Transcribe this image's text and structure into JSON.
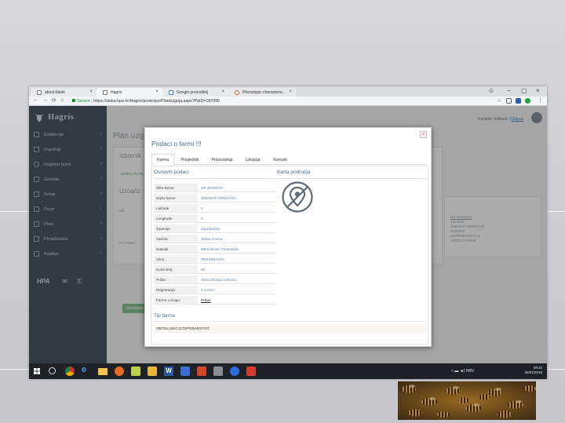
{
  "browser": {
    "tabs": [
      {
        "label": "about:blank"
      },
      {
        "label": "Hagris"
      },
      {
        "label": "Google prevoditelj"
      },
      {
        "label": "Phenotypic characteris..."
      }
    ],
    "url_secure": "Secure",
    "url": "https://stoka.hpa.hr/Hagris/pcele/pcePlanUzgoja.aspx?PplD=187095"
  },
  "app": {
    "logo_text": "Hagris",
    "user_line": "Korisnik: mdrazic |",
    "logout": "Odjava",
    "sidebar": [
      {
        "label": "Evidencije"
      },
      {
        "label": "Izvještaji"
      },
      {
        "label": "Registar farmi"
      },
      {
        "label": "Goveda"
      },
      {
        "label": "Svinje"
      },
      {
        "label": "Ovce"
      },
      {
        "label": "Ptice"
      },
      {
        "label": "Perad/ostalo"
      },
      {
        "label": "Kopitari"
      }
    ],
    "footer_logo": "HPA",
    "bg": {
      "plan_title": "Plan uzg",
      "subheading": "Izbornik",
      "add_label": "DODAJ PLAN",
      "uzgoj_label": "Uzoa/iz",
      "tbl_label": "BR.",
      "plan_label": "PLANSKA",
      "right_values": [
        "HR 20193107",
        "1614056",
        "ZDENKO CRNKOVIĆ",
        "ZAGREB",
        "KUPERBANOVA 3",
        "10000 ZAGREB"
      ],
      "save_btn": "Odustani"
    }
  },
  "modal": {
    "title": "Podaci o farmi !!!",
    "close_label": "×",
    "tabs": [
      "Farma",
      "Posjednik",
      "Proizvodnja",
      "Lokacija",
      "Kontakt"
    ],
    "section_basic": "Osnovni podaci",
    "section_map": "Karta područja",
    "fields": [
      {
        "label": "Šifra farme",
        "value": "HR 20193107"
      },
      {
        "label": "Naziv farme",
        "value": "ZDENKO CRNKOVIĆ"
      },
      {
        "label": "Latitude",
        "value": "0"
      },
      {
        "label": "Longitude",
        "value": "0"
      },
      {
        "label": "Županija",
        "value": "Zagrebačka"
      },
      {
        "label": "Općina",
        "value": "Velika Gorica"
      },
      {
        "label": "Naselje",
        "value": "Markuševec Turopoljski"
      },
      {
        "label": "Ulica",
        "value": "PERŠINOVEC"
      },
      {
        "label": "Kućni broj",
        "value": "85"
      },
      {
        "label": "Pošta",
        "value": "10412 Donja Lomnica"
      },
      {
        "label": "Registracija",
        "value": "1.4.2017."
      },
      {
        "label": "Farme u krugu:",
        "value": "Prikaz"
      }
    ],
    "section_tip": "Tip farme",
    "tip_value": "OBITELJSKO GOSPODARSTVO"
  },
  "taskbar": {
    "lang": "HRV",
    "time": "09:22",
    "date": "26/01/2018"
  }
}
